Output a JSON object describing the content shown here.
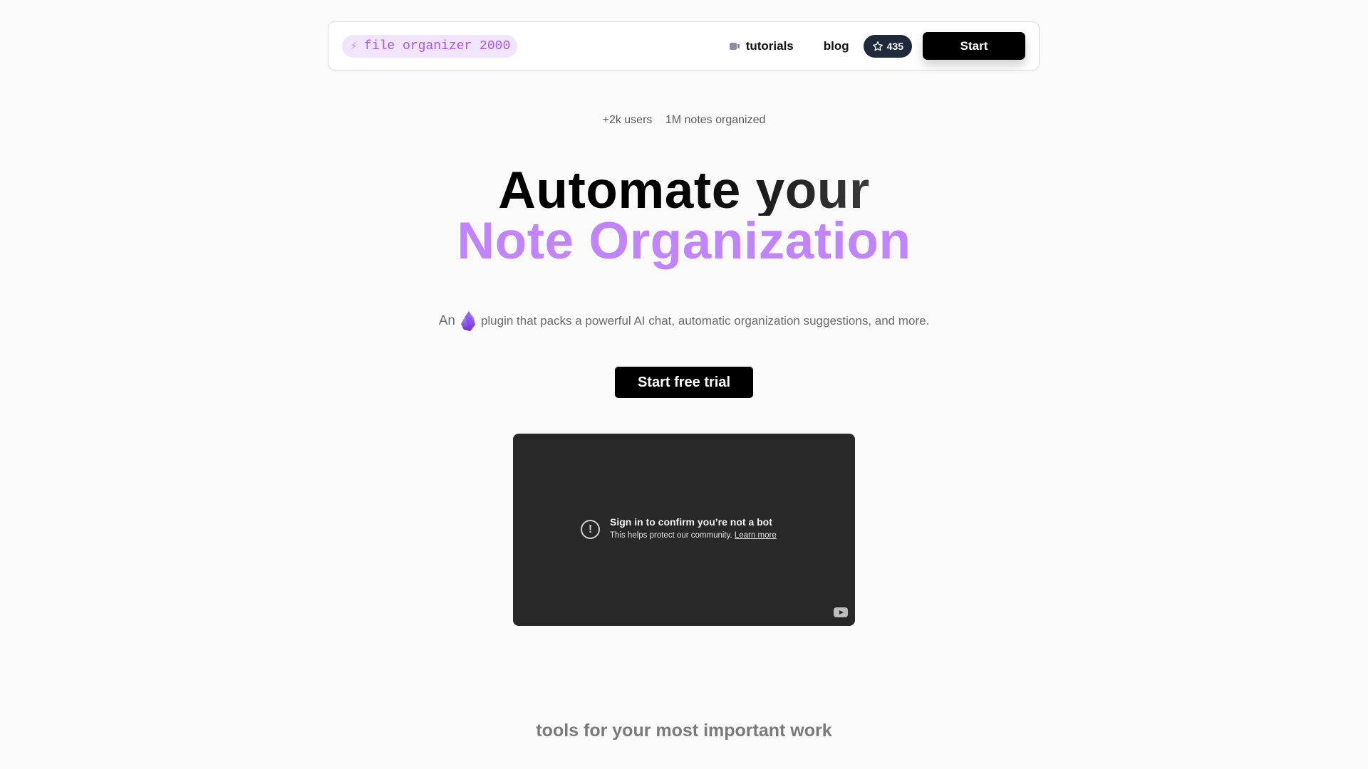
{
  "nav": {
    "logo_label": "file organizer 2000",
    "logo_icon": "lightning-bolt-icon",
    "links": [
      {
        "label": "tutorials",
        "icon": "video-camera-icon"
      },
      {
        "label": "blog"
      }
    ],
    "github_stars": "435",
    "star_icon": "star-icon",
    "start_label": "Start"
  },
  "stats": {
    "users": "+2k users",
    "notes": "1M notes organized"
  },
  "hero": {
    "line1": "Automate your",
    "line2": "Note Organization",
    "subtitle_prefix": "An",
    "subtitle_icon": "obsidian-icon",
    "subtitle_text": "plugin that packs a powerful AI chat, automatic organization suggestions, and more.",
    "cta_label": "Start free trial"
  },
  "video": {
    "title": "Sign in to confirm you’re not a bot",
    "subtitle": "This helps protect our community.",
    "link": "Learn more",
    "alert_icon_glyph": "!"
  },
  "section": {
    "heading": "tools for your most important work"
  },
  "colors": {
    "accent": "#c084fc",
    "logo_pill_bg": "#f1e4fd",
    "logo_text": "#a855f7",
    "badge_bg": "#1e293b",
    "video_bg": "#282828"
  }
}
